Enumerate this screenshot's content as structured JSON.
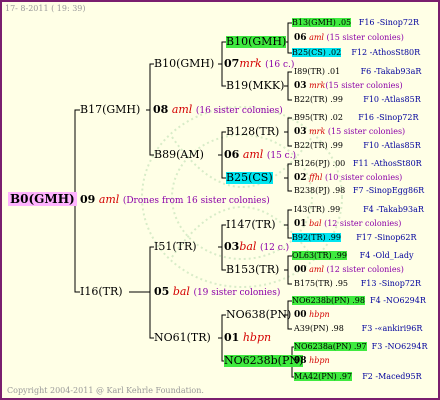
{
  "header": {
    "date": "17-  8-2011 ( 19: 39)"
  },
  "footer": {
    "copyright": "Copyright 2004-2011 @ Karl Kehrle Foundation."
  },
  "colors": {
    "border": "#7a1f6e",
    "background": "#ffffe6",
    "root": "#ffb3ff",
    "green": "#3fea3f",
    "cyan": "#00e5f0",
    "sisters": "#8b00a8",
    "accent": "#d40000",
    "link": "#00009c"
  },
  "root": {
    "label": "B0(GMH)",
    "num": "09",
    "mark": "aml",
    "note": "(Drones from 16 sister colonies)"
  },
  "gen1": {
    "top": {
      "label": "B17(GMH)",
      "num": "08",
      "mark": "aml",
      "note": "(16 sister colonies)"
    },
    "bottom": {
      "label": "I16(TR)",
      "num": "05",
      "mark": "bal",
      "note": "(19 sister colonies)"
    }
  },
  "gen2": {
    "a": {
      "label": "B10(GMH)",
      "num": "07",
      "mark": "mrk",
      "note": "(16 c.)"
    },
    "b": {
      "label": "B89(AM)",
      "num": "06",
      "mark": "aml",
      "note": "(15 c.)"
    },
    "c": {
      "label": "I51(TR)",
      "num": "03",
      "mark": "bal",
      "note": "(12 c.)"
    },
    "d": {
      "label": "NO61(TR)",
      "num": "01",
      "mark": "hbpn",
      "note": ""
    }
  },
  "gen3": {
    "a1": "B10(GMH)",
    "a2": "B19(MKK)",
    "b1": "B128(TR)",
    "b2": "B25(CS)",
    "c1": "I147(TR)",
    "c2": "B153(TR)",
    "d1": "NO638(PN)",
    "d2": "NO6238b(PN)"
  },
  "leaves": [
    {
      "name": "B13(GMH) .05",
      "code": "F16 -Sinop72R"
    },
    {
      "num": "06",
      "mark": "aml",
      "note": "(15 sister colonies)"
    },
    {
      "name": "B25(CS) .02",
      "code": "F12 -AthosSt80R"
    },
    {
      "name": "I89(TR) .01",
      "code": "F6 -Takab93aR"
    },
    {
      "num": "03",
      "mark": "mrk",
      "note": "(15 sister colonies)"
    },
    {
      "name": "B22(TR) .99",
      "code": "F10 -Atlas85R"
    },
    {
      "name": "B95(TR) .02",
      "code": "F16 -Sinop72R"
    },
    {
      "num": "03",
      "mark": "mrk",
      "note": "(15 sister colonies)"
    },
    {
      "name": "B22(TR) .99",
      "code": "F10 -Atlas85R"
    },
    {
      "name": "B126(PJ) .00",
      "code": "F11 -AthosSt80R"
    },
    {
      "num": "02",
      "mark": "ffhl",
      "note": "(10 sister colonies)"
    },
    {
      "name": "B238(PJ) .98",
      "code": "F7 -SinopEgg86R"
    },
    {
      "name": "I43(TR) .99",
      "code": "F4 -Takab93aR"
    },
    {
      "num": "01",
      "mark": "bal",
      "note": "(12 sister colonies)"
    },
    {
      "name": "B92(TR) .99",
      "code": "F17 -Sinop62R"
    },
    {
      "name": "OL63(TR) .99",
      "code": "F4 -Old_Lady"
    },
    {
      "num": "00",
      "mark": "aml",
      "note": "(12 sister colonies)"
    },
    {
      "name": "B175(TR) .95",
      "code": "F13 -Sinop72R"
    },
    {
      "name": "NO6238b(PN) .98",
      "code": "F4 -NO6294R"
    },
    {
      "num": "00",
      "mark": "hbpn",
      "note": ""
    },
    {
      "name": "A39(PN) .98",
      "code": "F3 -«ankiri96R"
    },
    {
      "name": "NO6238a(PN) .97",
      "code": "F3 -NO6294R"
    },
    {
      "num": "98",
      "mark": "hbpn",
      "note": ""
    },
    {
      "name": "MA42(PN) .97",
      "code": "F2 -Maced95R"
    }
  ]
}
